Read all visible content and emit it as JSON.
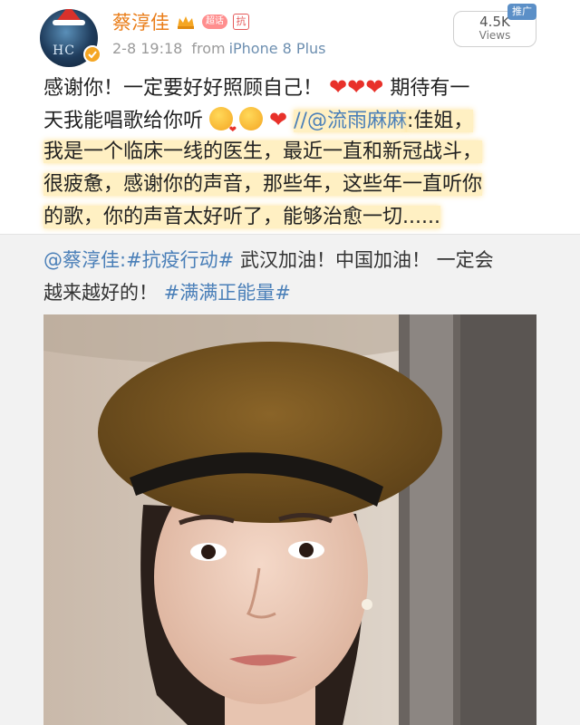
{
  "post": {
    "username": "蔡淳佳",
    "vip_badge": "超话",
    "kang_badge": "抗",
    "timestamp": "2-8 19:18",
    "device_prefix": "from",
    "device": "iPhone 8 Plus",
    "views_count": "4.5K",
    "views_label": "Views",
    "ad_tag": "推广",
    "avatar_text": "HC",
    "body": {
      "line1_a": "感谢你！一定要好好照顾自己！",
      "line1_b": "期待有一",
      "line2_a": "天我能唱歌给你听",
      "line2_mention": "//@流雨麻麻",
      "line2_b": ":佳姐，",
      "line3": "我是一个临床一线的医生，最近一直和新冠战斗，",
      "line4": "很疲惫，感谢你的声音，那些年，这些年一直听你",
      "line5": "的歌，你的声音太好听了，能够治愈一切......"
    }
  },
  "repost": {
    "mention": "@蔡淳佳",
    "topic1": ":#抗疫行动#",
    "text1": " 武汉加油！中国加油！ 一定会",
    "text2": "越来越好的！",
    "topic2": "#满满正能量#"
  },
  "colors": {
    "username": "#ea7e1a",
    "link": "#4a7fb8",
    "highlight": "#ffebaf",
    "heart": "#e8312a"
  }
}
